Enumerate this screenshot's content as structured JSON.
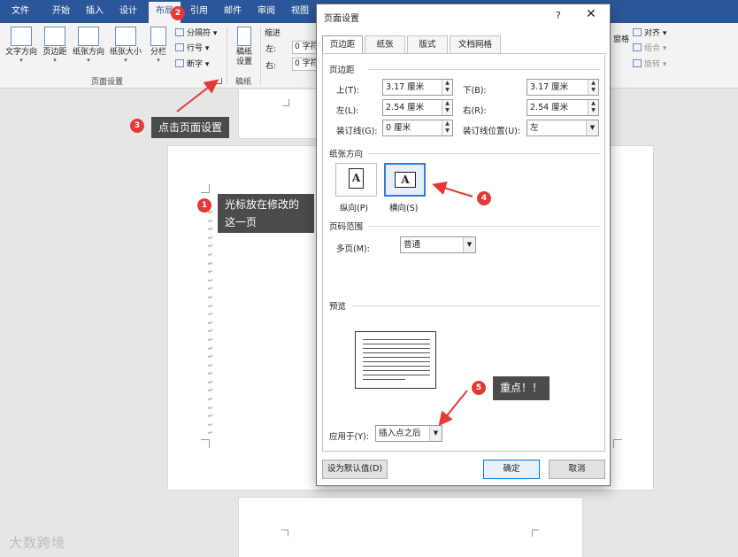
{
  "ribbon_tabs": [
    "文件",
    "开始",
    "插入",
    "设计",
    "布局",
    "引用",
    "邮件",
    "审阅",
    "视图"
  ],
  "ribbon": {
    "buttons": [
      "文字方向",
      "页边距",
      "纸张方向",
      "纸张大小",
      "分栏"
    ],
    "small": {
      "breaks": "分隔符",
      "line_numbers": "行号",
      "hyphenation": "断字"
    },
    "page_setup_group": "页面设置",
    "manuscript": {
      "line1": "稿纸",
      "line2": "设置",
      "group": "稿纸"
    },
    "indent": {
      "title": "缩进",
      "left": "左:",
      "right": "右:",
      "left_value": "0 字符",
      "right_value": "0 字符"
    },
    "right_side": {
      "pane": "窗格",
      "align": "对齐",
      "group": "组合",
      "rotate": "旋转"
    }
  },
  "callouts": {
    "c1": {
      "number": "1",
      "line1": "光标放在修改的",
      "line2": "这一页"
    },
    "c2": {
      "number": "2"
    },
    "c3": {
      "number": "3",
      "text": "点击页面设置"
    },
    "c4": {
      "number": "4"
    },
    "c5": {
      "number": "5",
      "text": "重点！！"
    }
  },
  "dialog": {
    "title": "页面设置",
    "help": "?",
    "close": "✕",
    "tabs": [
      "页边距",
      "纸张",
      "版式",
      "文档网格"
    ],
    "margins_section": "页边距",
    "fields": {
      "top_label": "上(T):",
      "top_value": "3.17 厘米",
      "bottom_label": "下(B):",
      "bottom_value": "3.17 厘米",
      "left_label": "左(L):",
      "left_value": "2.54 厘米",
      "right_label": "右(R):",
      "right_value": "2.54 厘米",
      "gutter_label": "装订线(G):",
      "gutter_value": "0 厘米",
      "gutter_pos_label": "装订线位置(U):",
      "gutter_pos_value": "左"
    },
    "orientation_section": "纸张方向",
    "portrait": "纵向(P)",
    "landscape": "横向(S)",
    "pages_section": "页码范围",
    "multiple_pages_label": "多页(M):",
    "multiple_pages_value": "普通",
    "preview_section": "预览",
    "apply_to_label": "应用于(Y):",
    "apply_to_value": "插入点之后",
    "set_default": "设为默认值(D)",
    "ok": "确定",
    "cancel": "取消"
  },
  "watermark": "大数跨境"
}
